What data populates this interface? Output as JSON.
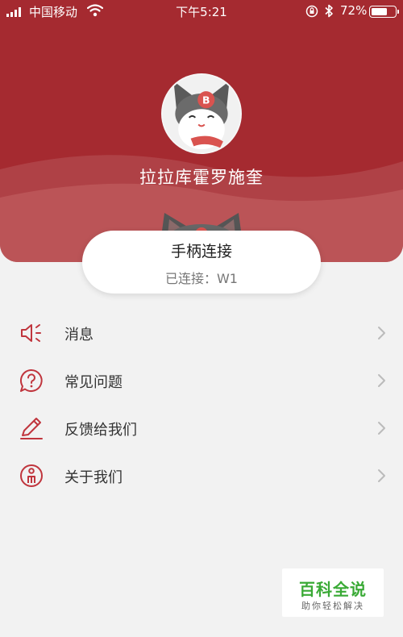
{
  "status_bar": {
    "carrier": "中国移动",
    "time": "下午5:21",
    "battery_pct": "72%",
    "battery_level": 0.72
  },
  "profile": {
    "username": "拉拉库霍罗施奎"
  },
  "connection": {
    "title": "手柄连接",
    "status": "已连接：W1"
  },
  "menu": {
    "items": [
      {
        "label": "消息",
        "icon": "speaker-icon"
      },
      {
        "label": "常见问题",
        "icon": "question-bubble-icon"
      },
      {
        "label": "反馈给我们",
        "icon": "pencil-icon"
      },
      {
        "label": "关于我们",
        "icon": "info-person-icon"
      }
    ]
  },
  "watermark": {
    "main": "百科全说",
    "sub": "助你轻松解决"
  },
  "colors": {
    "header": "#a52a30",
    "accent": "#c0353d",
    "background": "#f2f2f2",
    "watermark_green": "#3aaa36"
  }
}
